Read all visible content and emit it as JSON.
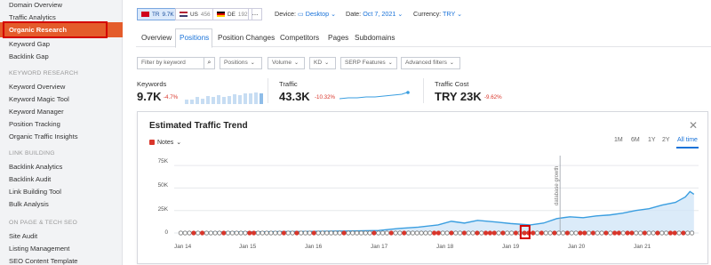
{
  "sidebar": {
    "items_top": [
      "Domain Overview",
      "Traffic Analytics"
    ],
    "active": "Organic Research",
    "items_after_active": [
      "Keyword Gap",
      "Backlink Gap"
    ],
    "sections": [
      {
        "title": "KEYWORD RESEARCH",
        "items": [
          "Keyword Overview",
          "Keyword Magic Tool",
          "Keyword Manager",
          "Position Tracking",
          "Organic Traffic Insights"
        ]
      },
      {
        "title": "LINK BUILDING",
        "items": [
          "Backlink Analytics",
          "Backlink Audit",
          "Link Building Tool",
          "Bulk Analysis"
        ]
      },
      {
        "title": "ON PAGE & TECH SEO",
        "items": [
          "Site Audit",
          "Listing Management",
          "SEO Content Template"
        ]
      }
    ]
  },
  "databases": [
    {
      "code": "TR",
      "count": "9.7K",
      "selected": true
    },
    {
      "code": "US",
      "count": "456",
      "selected": false
    },
    {
      "code": "DE",
      "count": "192",
      "selected": false
    }
  ],
  "more_label": "...",
  "device": {
    "label": "Device:",
    "value": "Desktop"
  },
  "date": {
    "label": "Date:",
    "value": "Oct 7, 2021"
  },
  "currency": {
    "label": "Currency:",
    "value": "TRY"
  },
  "tabs": [
    "Overview",
    "Positions",
    "Position Changes",
    "Competitors",
    "Pages",
    "Subdomains"
  ],
  "active_tab": "Positions",
  "filters": {
    "keyword_placeholder": "Filter by keyword",
    "dropdowns": [
      "Positions",
      "Volume",
      "KD",
      "SERP Features",
      "Advanced filters"
    ]
  },
  "kpis": {
    "keywords": {
      "label": "Keywords",
      "value": "9.7K",
      "delta": "-4.7%"
    },
    "traffic": {
      "label": "Traffic",
      "value": "43.3K",
      "delta": "-10.32%"
    },
    "traffic_cost": {
      "label": "Traffic Cost",
      "value": "TRY 23K",
      "delta": "-9.62%"
    }
  },
  "panel": {
    "title": "Estimated Traffic Trend",
    "notes_label": "Notes",
    "close": "✕",
    "ranges": [
      "1M",
      "6M",
      "1Y",
      "2Y",
      "All time"
    ],
    "active_range": "All time",
    "annotation": "database growth"
  },
  "colors": {
    "accent": "#1a73d9",
    "active_sidebar": "#e45c2b",
    "negative": "#d9362b",
    "area": "#cfe4f7",
    "line": "#3a9ee0"
  },
  "chart_data": {
    "type": "area",
    "title": "Estimated Traffic Trend",
    "x_ticks": [
      "Jan 14",
      "Jan 15",
      "Jan 16",
      "Jan 17",
      "Jan 18",
      "Jan 19",
      "Jan 20",
      "Jan 21"
    ],
    "y_ticks": [
      "0",
      "25K",
      "50K",
      "75K"
    ],
    "ylim": [
      0,
      80000
    ],
    "series": [
      {
        "values": [
          [
            2014.0,
            600
          ],
          [
            2014.5,
            900
          ],
          [
            2015.0,
            1200
          ],
          [
            2015.5,
            1500
          ],
          [
            2016.0,
            1800
          ],
          [
            2016.5,
            2200
          ],
          [
            2017.0,
            2800
          ],
          [
            2017.3,
            5000
          ],
          [
            2017.6,
            6500
          ],
          [
            2017.9,
            9000
          ],
          [
            2018.1,
            13000
          ],
          [
            2018.3,
            11000
          ],
          [
            2018.5,
            14000
          ],
          [
            2018.8,
            12000
          ],
          [
            2019.0,
            10500
          ],
          [
            2019.3,
            9000
          ],
          [
            2019.5,
            11000
          ],
          [
            2019.7,
            16000
          ],
          [
            2019.9,
            18000
          ],
          [
            2020.1,
            17000
          ],
          [
            2020.3,
            19000
          ],
          [
            2020.5,
            20000
          ],
          [
            2020.7,
            22000
          ],
          [
            2020.9,
            25000
          ],
          [
            2021.1,
            27000
          ],
          [
            2021.3,
            31000
          ],
          [
            2021.5,
            34000
          ],
          [
            2021.65,
            40000
          ],
          [
            2021.72,
            46000
          ],
          [
            2021.78,
            43000
          ]
        ]
      }
    ],
    "grid": true,
    "annotation": {
      "x": 2019.75,
      "label": "database growth"
    }
  }
}
